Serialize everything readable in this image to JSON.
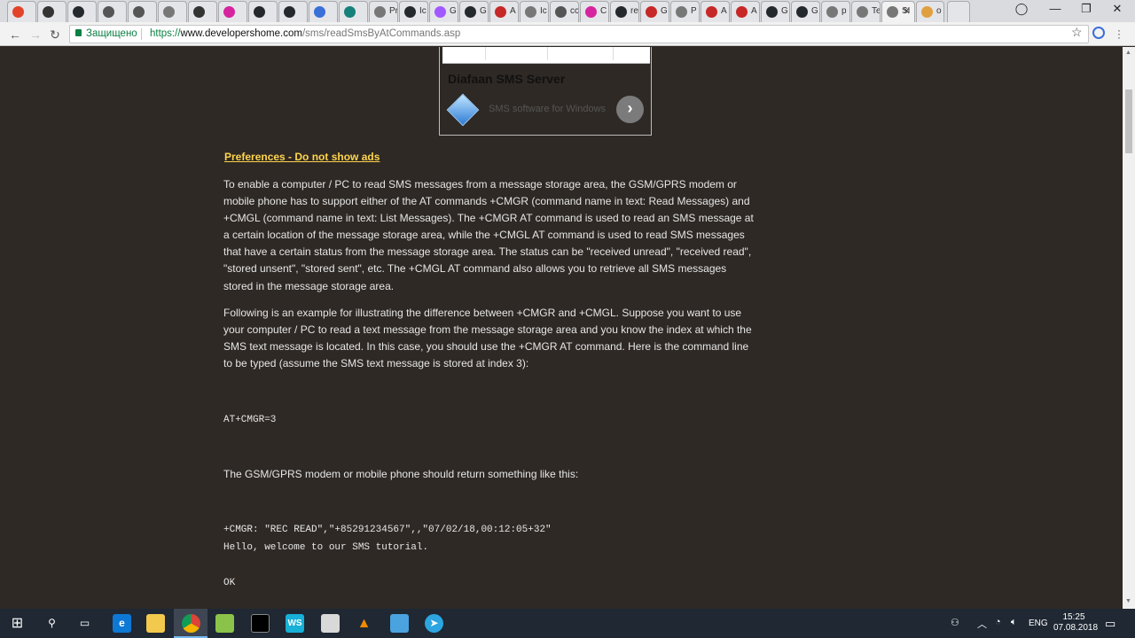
{
  "browser": {
    "tabs": [
      {
        "label": "",
        "icon": "gitlab-icon",
        "color": "#e24329"
      },
      {
        "label": "",
        "icon": "bookmark-icon",
        "color": "#333333"
      },
      {
        "label": "",
        "icon": "github-icon",
        "color": "#24292e"
      },
      {
        "label": "",
        "icon": "page-icon",
        "color": "#555555"
      },
      {
        "label": "",
        "icon": "book-icon",
        "color": "#555555"
      },
      {
        "label": "",
        "icon": "page-icon",
        "color": "#777777"
      },
      {
        "label": "",
        "icon": "rocket-icon",
        "color": "#333333"
      },
      {
        "label": "",
        "icon": "circle-icon",
        "color": "#d6249f"
      },
      {
        "label": "",
        "icon": "github-icon",
        "color": "#24292e"
      },
      {
        "label": "",
        "icon": "github-icon",
        "color": "#24292e"
      },
      {
        "label": "",
        "icon": "flag-icon",
        "color": "#3a6fd8"
      },
      {
        "label": "",
        "icon": "dot-icon",
        "color": "#16807a"
      },
      {
        "label": "Pr",
        "icon": "page-icon",
        "color": "#777777"
      },
      {
        "label": "Ic",
        "icon": "github-icon",
        "color": "#24292e"
      },
      {
        "label": "G",
        "icon": "figma-icon",
        "color": "#a259ff"
      },
      {
        "label": "G",
        "icon": "github-icon",
        "color": "#24292e"
      },
      {
        "label": "A",
        "icon": "pin-icon",
        "color": "#c62828"
      },
      {
        "label": "Ic",
        "icon": "page-icon",
        "color": "#777777"
      },
      {
        "label": "cc",
        "icon": "book-icon",
        "color": "#555555"
      },
      {
        "label": "C",
        "icon": "circle-icon",
        "color": "#d6249f"
      },
      {
        "label": "re",
        "icon": "github-icon",
        "color": "#24292e"
      },
      {
        "label": "G",
        "icon": "square-icon",
        "color": "#c62828"
      },
      {
        "label": "P",
        "icon": "page-icon",
        "color": "#777777"
      },
      {
        "label": "A",
        "icon": "square-icon",
        "color": "#c62828"
      },
      {
        "label": "A",
        "icon": "square-icon",
        "color": "#c62828"
      },
      {
        "label": "G",
        "icon": "github-icon",
        "color": "#24292e"
      },
      {
        "label": "G",
        "icon": "github-icon",
        "color": "#24292e"
      },
      {
        "label": "p",
        "icon": "page-icon",
        "color": "#777777"
      },
      {
        "label": "Te",
        "icon": "page-icon",
        "color": "#777777"
      },
      {
        "label": "SI",
        "icon": "page-icon",
        "color": "#777777",
        "active": true
      },
      {
        "label": "o",
        "icon": "pinned-icon",
        "color": "#e0a040"
      }
    ],
    "tab_close": "✕",
    "secure_label": "Защищено",
    "url_scheme": "https://",
    "url_host": "www.developershome.com",
    "url_path": "/sms/readSmsByAtCommands.asp"
  },
  "ad": {
    "title": "Diafaan SMS Server",
    "subtitle": "SMS software for Windows",
    "arrow": "›"
  },
  "content": {
    "pref_link": "Preferences - Do not show ads",
    "para1": "To enable a computer / PC to read SMS messages from a message storage area, the GSM/GPRS modem or mobile phone has to support either of the AT commands +CMGR (command name in text: Read Messages) and +CMGL (command name in text: List Messages). The +CMGR AT command is used to read an SMS message at a certain location of the message storage area, while the +CMGL AT command is used to read SMS messages that have a certain status from the message storage area. The status can be \"received unread\", \"received read\", \"stored unsent\", \"stored sent\", etc. The +CMGL AT command also allows you to retrieve all SMS messages stored in the message storage area.",
    "para2": "Following is an example for illustrating the difference between +CMGR and +CMGL. Suppose you want to use your computer / PC to read a text message from the message storage area and you know the index at which the SMS text message is located. In this case, you should use the +CMGR AT command. Here is the command line to be typed (assume the SMS text message is stored at index 3):",
    "code1": "AT+CMGR=3",
    "para3": "The GSM/GPRS modem or mobile phone should return something like this:",
    "code2_line1": "+CMGR: \"REC READ\",\"+85291234567\",,\"07/02/18,00:12:05+32\"",
    "code2_line2": "Hello, welcome to our SMS tutorial.",
    "code2_line3": "OK"
  },
  "taskbar": {
    "lang": "ENG",
    "time": "15:25",
    "date": "07.08.2018"
  }
}
